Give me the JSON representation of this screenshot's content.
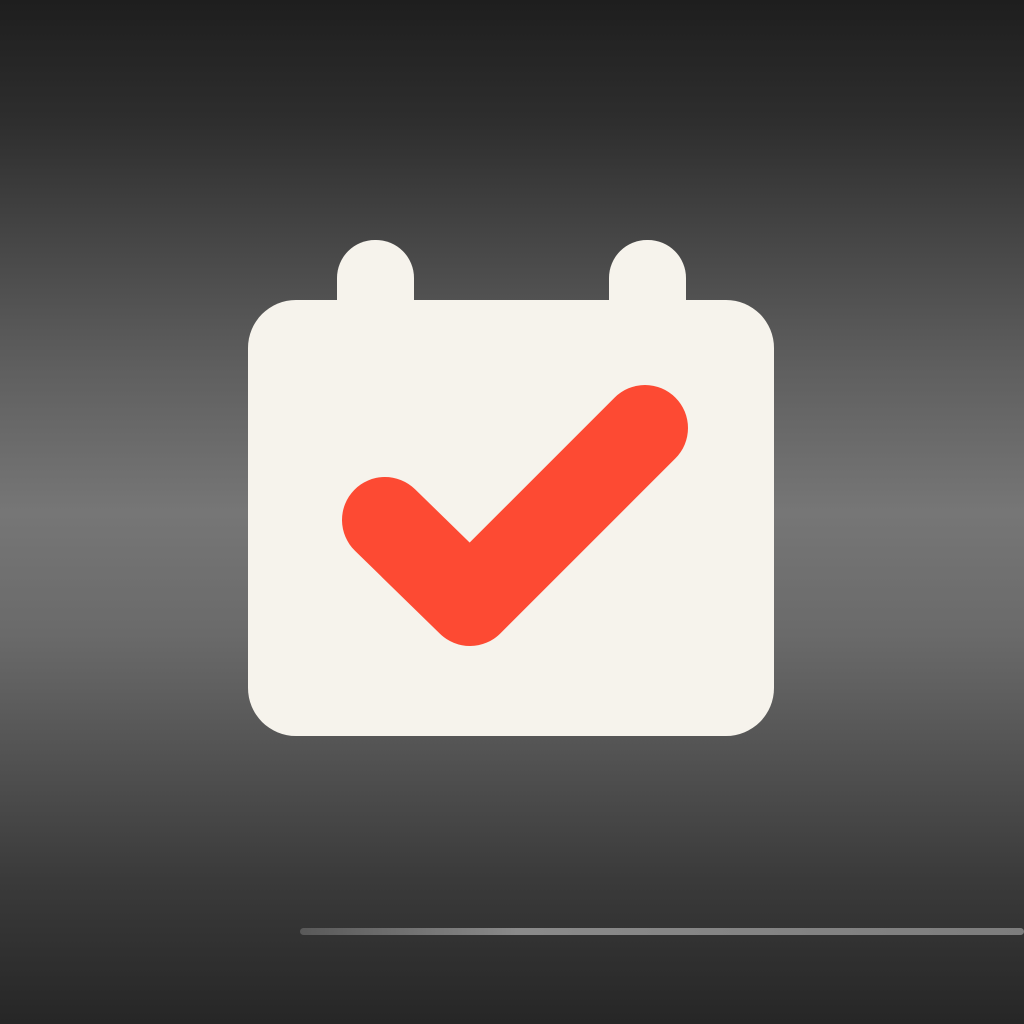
{
  "colors": {
    "background_top": "#1e1e1e",
    "background_mid": "#767676",
    "background_bottom": "#262626",
    "calendar_body": "#f6f3ec",
    "checkmark": "#fd4a33",
    "floor_line": "#8a8a8a"
  },
  "icon": {
    "name": "calendar-check-icon",
    "parts": [
      "calendar-body",
      "left-binding-ring",
      "right-binding-ring",
      "checkmark"
    ]
  }
}
